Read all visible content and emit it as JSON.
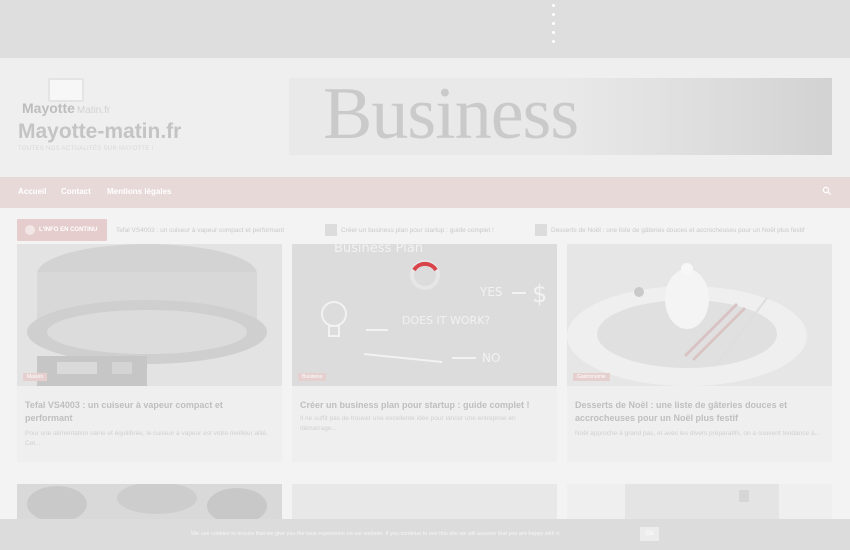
{
  "header": {
    "logo_text": "Mayotte",
    "logo_sub": "Matin.fr",
    "site_title": "Mayotte-matin.fr",
    "tagline": "TOUTES NOS ACTUALITÉS SUR MAYOTTE !",
    "banner_word": "Business"
  },
  "nav": {
    "items": [
      "Accueil",
      "Contact",
      "Mentions légales"
    ]
  },
  "ticker": {
    "label": "L'INFO EN CONTINU",
    "items": [
      "Tefal VS4003 : un cuiseur à vapeur compact et performant",
      "Créer un business plan pour startup : guide complet !",
      "Desserts de Noël : une liste de gâteries douces et accrocheuses pour un Noël plus festif"
    ]
  },
  "cards": [
    {
      "category": "Maison",
      "title": "Tefal VS4003 : un cuiseur à vapeur compact et performant",
      "excerpt": "Pour une alimentation saine et équilibrée, le cuiseur à vapeur est votre meilleur allié. Cet..."
    },
    {
      "category": "Business",
      "title": "Créer un business plan pour startup : guide complet !",
      "excerpt": "Il ne suffit pas de trouver une excellente idée pour lancer une entreprise en démarrage..."
    },
    {
      "category": "Gastronomie",
      "title": "Desserts de Noël : une liste de gâteries douces et accrocheuses pour un Noël plus festif",
      "excerpt": "Noël approche à grand pas, et avec les divers préparatifs, on a souvent tendance à..."
    }
  ],
  "card2_image_text": {
    "heading": "Business Plan",
    "yes": "YES",
    "no": "NO",
    "question": "DOES IT WORK?",
    "dollar": "$"
  },
  "cookie": {
    "message": "We use cookies to ensure that we give you the best experience on our website. If you continue to use this site we will assume that you are happy with it.",
    "ok_label": "Ok"
  },
  "colors": {
    "nav_bg": "#e8d9d9",
    "accent": "#e6cfcf",
    "loader": "#d9434a"
  }
}
